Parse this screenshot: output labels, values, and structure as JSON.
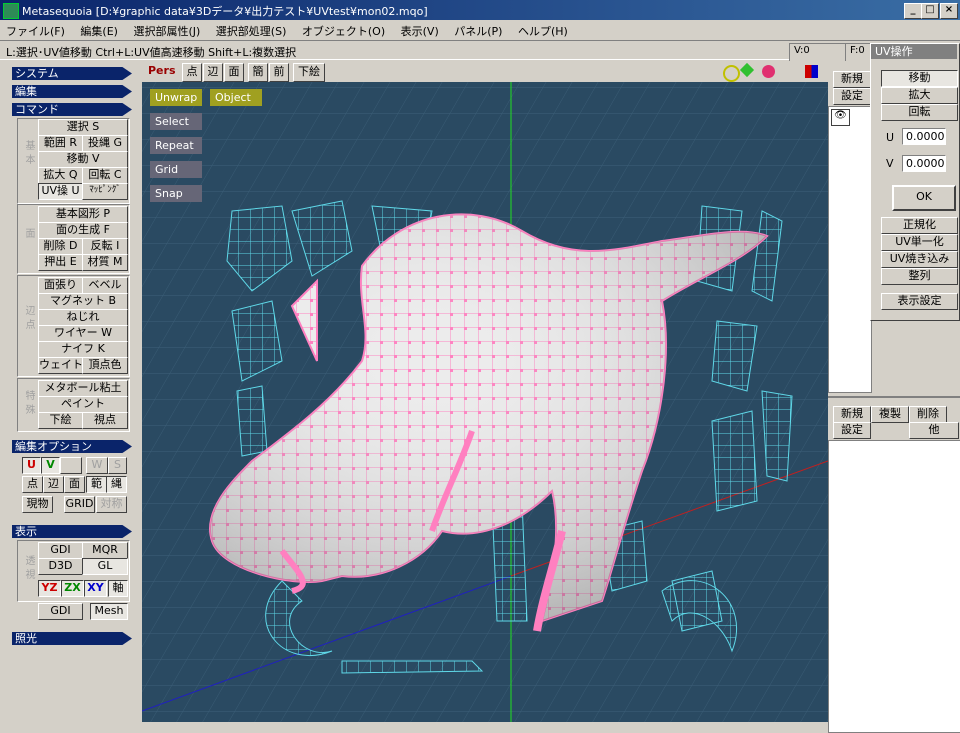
{
  "window": {
    "title": "Metasequoia [D:¥graphic data¥3Dデータ¥出力テスト¥UVtest¥mon02.mqo]"
  },
  "menu": [
    "ファイル(F)",
    "編集(E)",
    "選択部属性(J)",
    "選択部処理(S)",
    "オブジェクト(O)",
    "表示(V)",
    "パネル(P)",
    "ヘルプ(H)"
  ],
  "hint": "L:選択･UV値移動  Ctrl+L:UV値高速移動  Shift+L:複数選択",
  "counters": {
    "v": "V:0",
    "f": "F:0"
  },
  "left": {
    "system": "システム",
    "edit": "編集",
    "command": "コマンド",
    "groups": {
      "basic": "基本",
      "face": "面",
      "vertex": "辺点",
      "special": "特殊"
    },
    "cmd": {
      "select": "選択 S",
      "range": "範囲 R",
      "lasso": "投縄 G",
      "move": "移動 V",
      "scale": "拡大 Q",
      "rotate": "回転 C",
      "uv": "UV操 U",
      "mapping": "ﾏｯﾋﾟﾝｸﾞ",
      "primitive": "基本図形 P",
      "face_gen": "面の生成 F",
      "delete": "削除 D",
      "flip": "反転 I",
      "extrude": "押出 E",
      "material": "材質 M",
      "face_stretch": "面張り",
      "bevel": "ベベル",
      "magnet": "マグネット B",
      "twist": "ねじれ",
      "wire": "ワイヤー W",
      "knife": "ナイフ K",
      "weight": "ウェイト",
      "vcolor": "頂点色",
      "metaball": "メタボール粘土",
      "paint": "ペイント",
      "under": "下絵",
      "viewpoint": "視点"
    },
    "edit_opt": {
      "title": "編集オプション",
      "u": "U",
      "v": "V",
      "w": "W",
      "s": "S",
      "pt": "点",
      "edge": "辺",
      "face": "面",
      "range": "範",
      "rope": "縄",
      "current": "現物",
      "grid": "GRID",
      "sym": "対称"
    },
    "display": {
      "title": "表示",
      "group": "透視",
      "gdi": "GDI",
      "mqr": "MQR",
      "d3d": "D3D",
      "gl": "GL",
      "yz": "YZ",
      "zx": "ZX",
      "xy": "XY",
      "axis": "軸",
      "gdi2": "GDI",
      "mesh": "Mesh"
    },
    "light": "照光"
  },
  "viewport": {
    "mode": "Pers",
    "tools": [
      "点",
      "辺",
      "面",
      "簡",
      "前",
      "下絵"
    ],
    "buttons": [
      "Unwrap",
      "Object",
      "Select",
      "Repeat",
      "Grid",
      "Snap"
    ]
  },
  "uvpanel": {
    "title": "UV操作",
    "move": "移動",
    "scale": "拡大",
    "rotate": "回転",
    "u_label": "U",
    "u_value": "0.0000",
    "v_label": "V",
    "v_value": "0.0000",
    "ok": "OK",
    "normalize": "正規化",
    "uv_unify": "UV単一化",
    "uv_bake": "UV焼き込み",
    "align": "整列",
    "disp": "表示設定"
  },
  "objpanel": {
    "new": "新規",
    "settings": "設定"
  },
  "matpanel": {
    "new": "新規",
    "copy": "複製",
    "delete": "削除",
    "settings": "設定",
    "other": "他"
  },
  "colors": {
    "titlebar": "#0a246a",
    "viewport": "#2a4a62",
    "uvwire": "#5fd8e8",
    "mesh": "#e8e8e8",
    "vertex": "#ff80c0"
  }
}
